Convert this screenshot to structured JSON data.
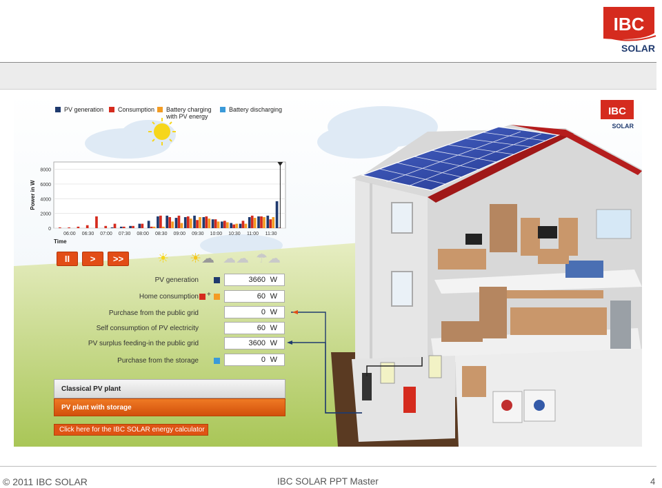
{
  "footer": {
    "copyright": "© 2011 IBC SOLAR",
    "center": "IBC SOLAR PPT Master",
    "page_number": "4"
  },
  "logo": {
    "brand": "IBC",
    "sub": "SOLAR",
    "color": "#d52b1e"
  },
  "legend": [
    {
      "label": "PV generation",
      "color": "#1f3a6e"
    },
    {
      "label": "Consumption",
      "color": "#d52b1e"
    },
    {
      "label": "Battery charging\nwith PV energy",
      "color": "#f39c23"
    },
    {
      "label": "Battery discharging",
      "color": "#3a9ad9"
    }
  ],
  "chart_data": {
    "type": "bar",
    "ylabel": "Power in W",
    "xlabel": "Time",
    "ylim": [
      0,
      9000
    ],
    "yticks": [
      0,
      2000,
      4000,
      6000,
      8000
    ],
    "x_tick_labels": [
      "06:00",
      "06:30",
      "07:00",
      "07:30",
      "08:00",
      "08:30",
      "09:00",
      "09:30",
      "10:00",
      "10:30",
      "11:00",
      "11:30"
    ],
    "categories": [
      "05:45",
      "06:00",
      "06:15",
      "06:30",
      "06:45",
      "07:00",
      "07:15",
      "07:30",
      "07:45",
      "08:00",
      "08:15",
      "08:30",
      "08:45",
      "09:00",
      "09:15",
      "09:30",
      "09:45",
      "10:00",
      "10:15",
      "10:30",
      "10:45",
      "11:00",
      "11:15",
      "11:30",
      "11:45"
    ],
    "series": [
      {
        "name": "PV generation",
        "values": [
          0,
          0,
          0,
          0,
          0,
          0,
          100,
          200,
          300,
          600,
          1000,
          1600,
          1700,
          1400,
          1500,
          1700,
          1500,
          1200,
          900,
          700,
          600,
          1500,
          1600,
          1700,
          3660
        ]
      },
      {
        "name": "Consumption",
        "values": [
          100,
          100,
          200,
          400,
          1600,
          300,
          600,
          200,
          300,
          600,
          200,
          1700,
          1500,
          1700,
          1600,
          1100,
          1600,
          1200,
          1000,
          500,
          1000,
          1700,
          1600,
          1200,
          60
        ]
      },
      {
        "name": "Battery charging with PV energy",
        "values": [
          0,
          0,
          0,
          0,
          0,
          0,
          0,
          0,
          0,
          0,
          200,
          200,
          900,
          700,
          1300,
          1500,
          1300,
          900,
          800,
          600,
          600,
          1400,
          1500,
          1500,
          0
        ]
      },
      {
        "name": "Battery discharging",
        "values": [
          0,
          0,
          0,
          0,
          0,
          0,
          0,
          0,
          0,
          0,
          0,
          0,
          0,
          0,
          0,
          0,
          0,
          0,
          0,
          0,
          0,
          0,
          0,
          0,
          0
        ]
      }
    ],
    "current_marker": "11:45"
  },
  "controls": {
    "pause": "II",
    "play": ">",
    "fast": ">>"
  },
  "weather_icons": [
    "sun-icon",
    "sun-cloud-icon",
    "cloud-icon",
    "rain-icon"
  ],
  "rows": [
    {
      "label": "PV generation",
      "value": "3660",
      "unit": "W"
    },
    {
      "label": "Home consumption",
      "value": "60",
      "unit": "W"
    },
    {
      "label": "Purchase from the public grid",
      "value": "0",
      "unit": "W"
    },
    {
      "label": "Self consumption of PV electricity",
      "value": "60",
      "unit": "W"
    },
    {
      "label": "PV surplus feeding-in the public grid",
      "value": "3600",
      "unit": "W"
    },
    {
      "label": "Purchase from the storage",
      "value": "0",
      "unit": "W"
    }
  ],
  "home_consumption_plus": "+",
  "modes": {
    "classical": "Classical PV plant",
    "storage": "PV plant with storage"
  },
  "calculator_button": "Click here for the IBC SOLAR energy calculator"
}
